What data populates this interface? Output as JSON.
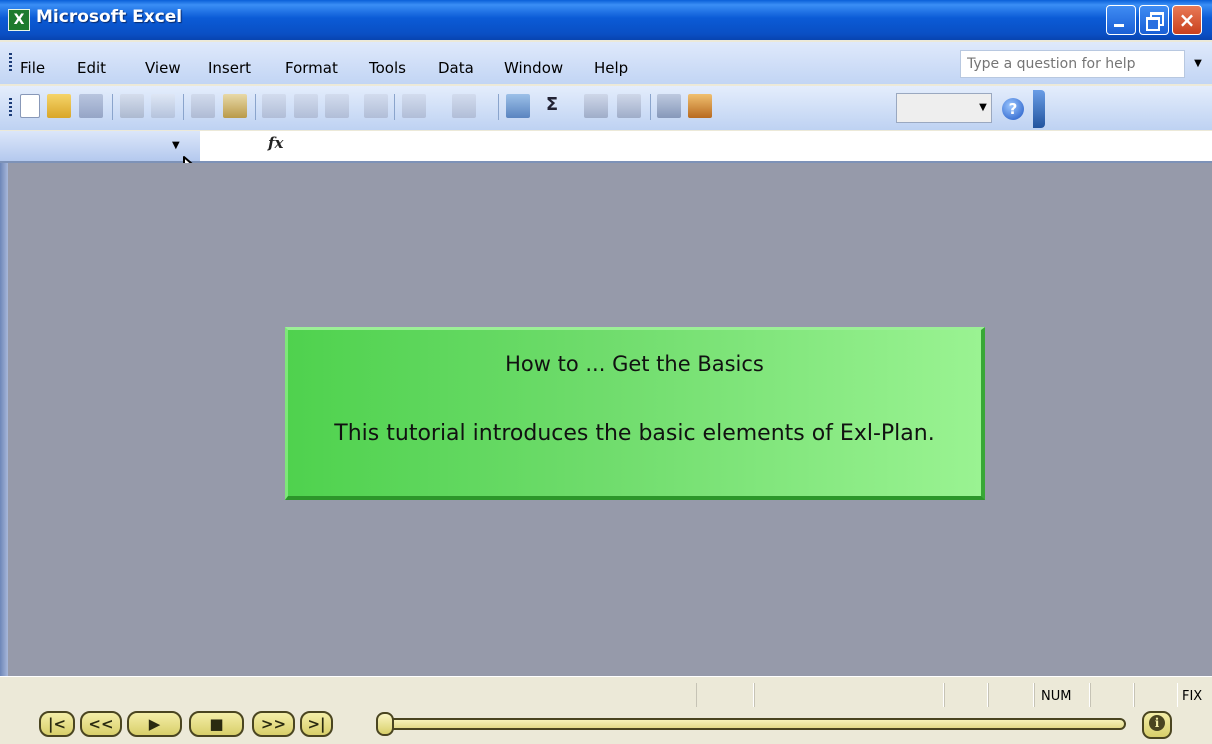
{
  "window": {
    "title": "Microsoft Excel"
  },
  "menu": {
    "items": [
      {
        "label": "File"
      },
      {
        "label": "Edit"
      },
      {
        "label": "View"
      },
      {
        "label": "Insert"
      },
      {
        "label": "Format"
      },
      {
        "label": "Tools"
      },
      {
        "label": "Data"
      },
      {
        "label": "Window"
      },
      {
        "label": "Help"
      }
    ],
    "help_placeholder": "Type a question for help"
  },
  "formula_bar": {
    "fx_label": "fx"
  },
  "tutorial": {
    "title": "How to ... Get the Basics",
    "description": "This tutorial introduces the basic elements of Exl-Plan."
  },
  "status": {
    "num": "NUM",
    "fix": "FIX"
  },
  "player": {
    "buttons": [
      "|<",
      "<<",
      "▶",
      "■",
      ">>",
      ">|"
    ],
    "info": "i"
  },
  "colors": {
    "title_bar": "#0a5fd8",
    "workspace": "#969aaa",
    "tutorial_box": "#6fdc6c",
    "player": "#f4eea8"
  }
}
